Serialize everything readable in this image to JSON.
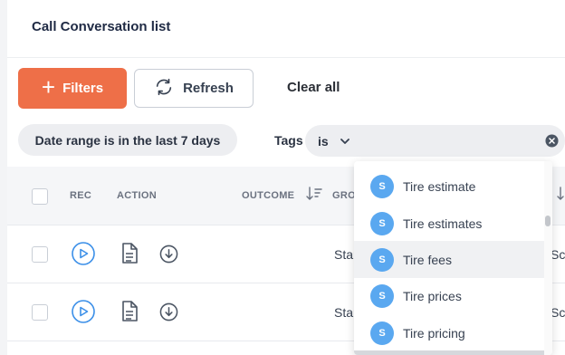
{
  "page": {
    "title": "Call Conversation list"
  },
  "toolbar": {
    "filters_label": "Filters",
    "refresh_label": "Refresh",
    "clear_all_label": "Clear all"
  },
  "filters": {
    "date_chip": "Date range is in the last 7 days",
    "tags_label": "Tags",
    "tags_operator": "is"
  },
  "table": {
    "columns": [
      "REC",
      "ACTION",
      "OUTCOME",
      "GRO"
    ],
    "rows": [
      {
        "group_text": "Star",
        "right_text": "Sc"
      },
      {
        "group_text": "Star",
        "right_text": "Sc"
      }
    ]
  },
  "dropdown": {
    "options": [
      {
        "avatar": "S",
        "label": "Tire estimate"
      },
      {
        "avatar": "S",
        "label": "Tire estimates"
      },
      {
        "avatar": "S",
        "label": "Tire fees",
        "highlighted": true
      },
      {
        "avatar": "S",
        "label": "Tire prices"
      },
      {
        "avatar": "S",
        "label": "Tire pricing"
      }
    ]
  },
  "colors": {
    "accent": "#ee6f48",
    "avatar": "#5aa8f0",
    "play_icon": "#3b8fe8"
  },
  "icons": [
    "plus-icon",
    "refresh-icon",
    "chevron-down-icon",
    "clear-icon",
    "sort-icon",
    "play-icon",
    "document-icon",
    "download-icon"
  ]
}
